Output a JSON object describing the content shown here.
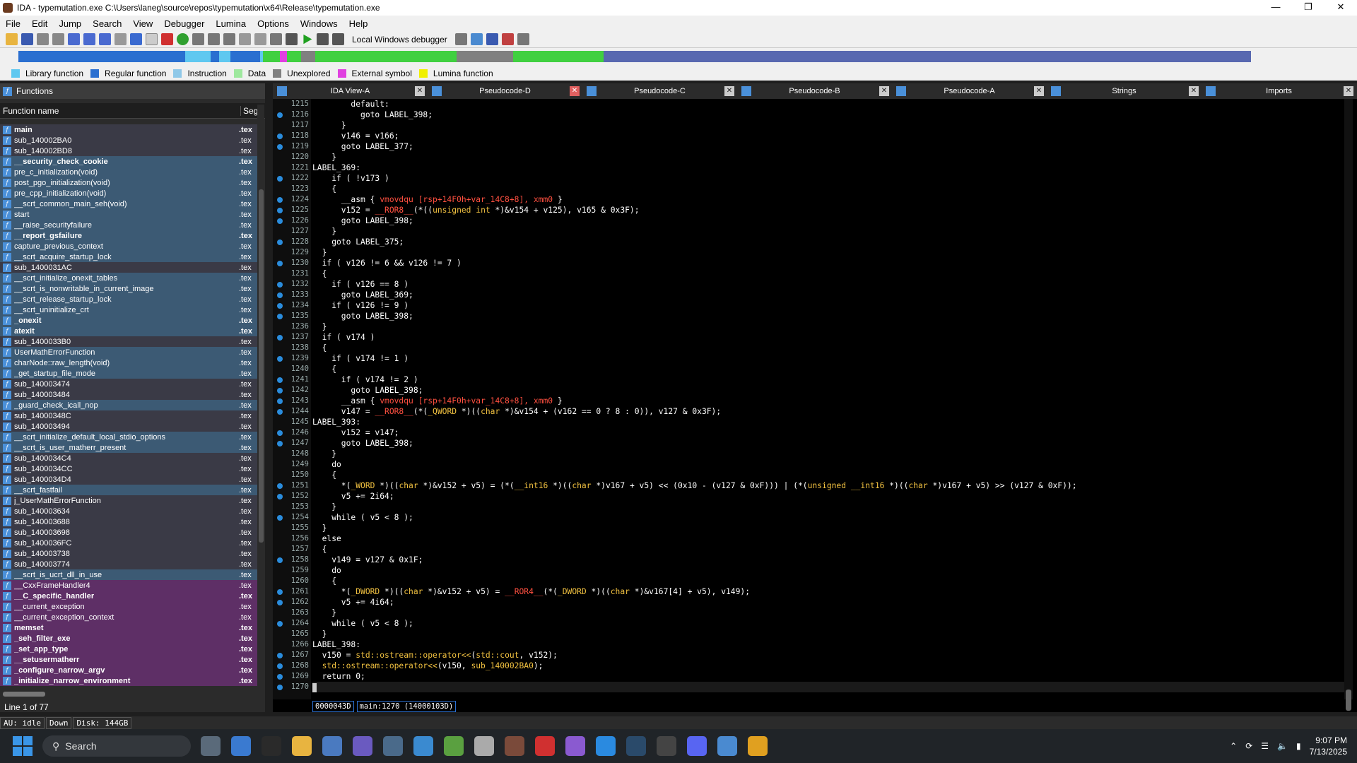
{
  "window": {
    "title": "IDA - typemutation.exe C:\\Users\\laneg\\source\\repos\\typemutation\\x64\\Release\\typemutation.exe",
    "minimize": "—",
    "maximize": "❐",
    "close": "✕"
  },
  "menu": [
    "File",
    "Edit",
    "Jump",
    "Search",
    "View",
    "Debugger",
    "Lumina",
    "Options",
    "Windows",
    "Help"
  ],
  "toolbar": {
    "debugger_label": "Local Windows debugger"
  },
  "legend": [
    {
      "label": "Library function",
      "color": "#5fc8f0"
    },
    {
      "label": "Regular function",
      "color": "#2a6fd0"
    },
    {
      "label": "Instruction",
      "color": "#8fc8e8"
    },
    {
      "label": "Data",
      "color": "#9ee89e"
    },
    {
      "label": "Unexplored",
      "color": "#808080"
    },
    {
      "label": "External symbol",
      "color": "#e040e0"
    },
    {
      "label": "Lumina function",
      "color": "#f0f000"
    }
  ],
  "functions_panel": {
    "title": "Functions",
    "col_name": "Function name",
    "col_seg": "Seg",
    "status": "Line 1 of 77",
    "rows": [
      {
        "name": "main",
        "seg": ".tex",
        "bold": true,
        "kind": "reg"
      },
      {
        "name": "sub_140002BA0",
        "seg": ".tex",
        "bold": false,
        "kind": "reg"
      },
      {
        "name": "sub_140002BD8",
        "seg": ".tex",
        "bold": false,
        "kind": "reg"
      },
      {
        "name": "__security_check_cookie",
        "seg": ".tex",
        "bold": true,
        "kind": "lib"
      },
      {
        "name": "pre_c_initialization(void)",
        "seg": ".tex",
        "bold": false,
        "kind": "lib"
      },
      {
        "name": "post_pgo_initialization(void)",
        "seg": ".tex",
        "bold": false,
        "kind": "lib"
      },
      {
        "name": "pre_cpp_initialization(void)",
        "seg": ".tex",
        "bold": false,
        "kind": "lib"
      },
      {
        "name": "__scrt_common_main_seh(void)",
        "seg": ".tex",
        "bold": false,
        "kind": "lib"
      },
      {
        "name": "start",
        "seg": ".tex",
        "bold": false,
        "kind": "lib"
      },
      {
        "name": "__raise_securityfailure",
        "seg": ".tex",
        "bold": false,
        "kind": "lib"
      },
      {
        "name": "__report_gsfailure",
        "seg": ".tex",
        "bold": true,
        "kind": "lib"
      },
      {
        "name": "capture_previous_context",
        "seg": ".tex",
        "bold": false,
        "kind": "lib"
      },
      {
        "name": "__scrt_acquire_startup_lock",
        "seg": ".tex",
        "bold": false,
        "kind": "lib"
      },
      {
        "name": "sub_1400031AC",
        "seg": ".tex",
        "bold": false,
        "kind": "reg"
      },
      {
        "name": "__scrt_initialize_onexit_tables",
        "seg": ".tex",
        "bold": false,
        "kind": "lib"
      },
      {
        "name": "__scrt_is_nonwritable_in_current_image",
        "seg": ".tex",
        "bold": false,
        "kind": "lib"
      },
      {
        "name": "__scrt_release_startup_lock",
        "seg": ".tex",
        "bold": false,
        "kind": "lib"
      },
      {
        "name": "__scrt_uninitialize_crt",
        "seg": ".tex",
        "bold": false,
        "kind": "lib"
      },
      {
        "name": "_onexit",
        "seg": ".tex",
        "bold": true,
        "kind": "lib"
      },
      {
        "name": "atexit",
        "seg": ".tex",
        "bold": true,
        "kind": "lib"
      },
      {
        "name": "sub_1400033B0",
        "seg": ".tex",
        "bold": false,
        "kind": "reg"
      },
      {
        "name": "UserMathErrorFunction",
        "seg": ".tex",
        "bold": false,
        "kind": "lib"
      },
      {
        "name": "charNode::raw_length(void)",
        "seg": ".tex",
        "bold": false,
        "kind": "lib"
      },
      {
        "name": "_get_startup_file_mode",
        "seg": ".tex",
        "bold": false,
        "kind": "lib"
      },
      {
        "name": "sub_140003474",
        "seg": ".tex",
        "bold": false,
        "kind": "reg"
      },
      {
        "name": "sub_140003484",
        "seg": ".tex",
        "bold": false,
        "kind": "reg"
      },
      {
        "name": "_guard_check_icall_nop",
        "seg": ".tex",
        "bold": false,
        "kind": "lib"
      },
      {
        "name": "sub_14000348C",
        "seg": ".tex",
        "bold": false,
        "kind": "reg"
      },
      {
        "name": "sub_140003494",
        "seg": ".tex",
        "bold": false,
        "kind": "reg"
      },
      {
        "name": "__scrt_initialize_default_local_stdio_options",
        "seg": ".tex",
        "bold": false,
        "kind": "lib"
      },
      {
        "name": "__scrt_is_user_matherr_present",
        "seg": ".tex",
        "bold": false,
        "kind": "lib"
      },
      {
        "name": "sub_1400034C4",
        "seg": ".tex",
        "bold": false,
        "kind": "reg"
      },
      {
        "name": "sub_1400034CC",
        "seg": ".tex",
        "bold": false,
        "kind": "reg"
      },
      {
        "name": "sub_1400034D4",
        "seg": ".tex",
        "bold": false,
        "kind": "reg"
      },
      {
        "name": "__scrt_fastfail",
        "seg": ".tex",
        "bold": false,
        "kind": "lib"
      },
      {
        "name": "j_UserMathErrorFunction",
        "seg": ".tex",
        "bold": false,
        "kind": "reg"
      },
      {
        "name": "sub_140003634",
        "seg": ".tex",
        "bold": false,
        "kind": "reg"
      },
      {
        "name": "sub_140003688",
        "seg": ".tex",
        "bold": false,
        "kind": "reg"
      },
      {
        "name": "sub_140003698",
        "seg": ".tex",
        "bold": false,
        "kind": "reg"
      },
      {
        "name": "sub_1400036FC",
        "seg": ".tex",
        "bold": false,
        "kind": "reg"
      },
      {
        "name": "sub_140003738",
        "seg": ".tex",
        "bold": false,
        "kind": "reg"
      },
      {
        "name": "sub_140003774",
        "seg": ".tex",
        "bold": false,
        "kind": "reg"
      },
      {
        "name": "__scrt_is_ucrt_dll_in_use",
        "seg": ".tex",
        "bold": false,
        "kind": "lib"
      },
      {
        "name": "__CxxFrameHandler4",
        "seg": ".tex",
        "bold": false,
        "kind": "ext"
      },
      {
        "name": "__C_specific_handler",
        "seg": ".tex",
        "bold": true,
        "kind": "ext"
      },
      {
        "name": "__current_exception",
        "seg": ".tex",
        "bold": false,
        "kind": "ext"
      },
      {
        "name": "__current_exception_context",
        "seg": ".tex",
        "bold": false,
        "kind": "ext"
      },
      {
        "name": "memset",
        "seg": ".tex",
        "bold": true,
        "kind": "ext"
      },
      {
        "name": "_seh_filter_exe",
        "seg": ".tex",
        "bold": true,
        "kind": "ext"
      },
      {
        "name": "_set_app_type",
        "seg": ".tex",
        "bold": true,
        "kind": "ext"
      },
      {
        "name": "__setusermatherr",
        "seg": ".tex",
        "bold": true,
        "kind": "ext"
      },
      {
        "name": "_configure_narrow_argv",
        "seg": ".tex",
        "bold": true,
        "kind": "ext"
      },
      {
        "name": "_initialize_narrow_environment",
        "seg": ".tex",
        "bold": true,
        "kind": "ext"
      }
    ]
  },
  "tabs": [
    {
      "label": "IDA View-A",
      "active": false
    },
    {
      "label": "Pseudocode-D",
      "active": true
    },
    {
      "label": "Pseudocode-C",
      "active": false
    },
    {
      "label": "Pseudocode-B",
      "active": false
    },
    {
      "label": "Pseudocode-A",
      "active": false
    },
    {
      "label": "Strings",
      "active": false
    },
    {
      "label": "Imports",
      "active": false
    }
  ],
  "code": {
    "lines": [
      {
        "n": "1215",
        "dot": false,
        "html": "        default:"
      },
      {
        "n": "1216",
        "dot": true,
        "html": "          goto LABEL_398;"
      },
      {
        "n": "1217",
        "dot": false,
        "html": "      }"
      },
      {
        "n": "1218",
        "dot": true,
        "html": "      v146 = v166;"
      },
      {
        "n": "1219",
        "dot": true,
        "html": "      goto LABEL_377;"
      },
      {
        "n": "1220",
        "dot": false,
        "html": "    }"
      },
      {
        "n": "1221",
        "dot": false,
        "html": "LABEL_369:"
      },
      {
        "n": "1222",
        "dot": true,
        "html": "    if ( !v173 )"
      },
      {
        "n": "1223",
        "dot": false,
        "html": "    {"
      },
      {
        "n": "1224",
        "dot": true,
        "html": "      __asm { <span class=\"a\">vmovdqu [rsp+14F0h+var_14C8+8], xmm0</span> }"
      },
      {
        "n": "1225",
        "dot": true,
        "html": "      v152 = <span class=\"a\">__ROR8__</span>(*((<span class=\"t\">unsigned int</span> *)&amp;v154 + v125), v165 &amp; 0x3F);"
      },
      {
        "n": "1226",
        "dot": true,
        "html": "      goto LABEL_398;"
      },
      {
        "n": "1227",
        "dot": false,
        "html": "    }"
      },
      {
        "n": "1228",
        "dot": true,
        "html": "    goto LABEL_375;"
      },
      {
        "n": "1229",
        "dot": false,
        "html": "  }"
      },
      {
        "n": "1230",
        "dot": true,
        "html": "  if ( v126 != 6 &amp;&amp; v126 != 7 )"
      },
      {
        "n": "1231",
        "dot": false,
        "html": "  {"
      },
      {
        "n": "1232",
        "dot": true,
        "html": "    if ( v126 == 8 )"
      },
      {
        "n": "1233",
        "dot": true,
        "html": "      goto LABEL_369;"
      },
      {
        "n": "1234",
        "dot": true,
        "html": "    if ( v126 != 9 )"
      },
      {
        "n": "1235",
        "dot": true,
        "html": "      goto LABEL_398;"
      },
      {
        "n": "1236",
        "dot": false,
        "html": "  }"
      },
      {
        "n": "1237",
        "dot": true,
        "html": "  if ( v174 )"
      },
      {
        "n": "1238",
        "dot": false,
        "html": "  {"
      },
      {
        "n": "1239",
        "dot": true,
        "html": "    if ( v174 != 1 )"
      },
      {
        "n": "1240",
        "dot": false,
        "html": "    {"
      },
      {
        "n": "1241",
        "dot": true,
        "html": "      if ( v174 != 2 )"
      },
      {
        "n": "1242",
        "dot": true,
        "html": "        goto LABEL_398;"
      },
      {
        "n": "1243",
        "dot": true,
        "html": "      __asm { <span class=\"a\">vmovdqu [rsp+14F0h+var_14C8+8], xmm0</span> }"
      },
      {
        "n": "1244",
        "dot": true,
        "html": "      v147 = <span class=\"a\">__ROR8__</span>(*(<span class=\"t\">_QWORD</span> *)((<span class=\"t\">char</span> *)&amp;v154 + (v162 == 0 ? 8 : 0)), v127 &amp; 0x3F);"
      },
      {
        "n": "1245",
        "dot": false,
        "html": "LABEL_393:"
      },
      {
        "n": "1246",
        "dot": true,
        "html": "      v152 = v147;"
      },
      {
        "n": "1247",
        "dot": true,
        "html": "      goto LABEL_398;"
      },
      {
        "n": "1248",
        "dot": false,
        "html": "    }"
      },
      {
        "n": "1249",
        "dot": false,
        "html": "    do"
      },
      {
        "n": "1250",
        "dot": false,
        "html": "    {"
      },
      {
        "n": "1251",
        "dot": true,
        "html": "      *(<span class=\"t\">_WORD</span> *)((<span class=\"t\">char</span> *)&amp;v152 + v5) = (*(<span class=\"t\">__int16</span> *)((<span class=\"t\">char</span> *)v167 + v5) &lt;&lt; (0x10 - (v127 &amp; 0xF))) | (*(<span class=\"t\">unsigned __int16</span> *)((<span class=\"t\">char</span> *)v167 + v5) &gt;&gt; (v127 &amp; 0xF));"
      },
      {
        "n": "1252",
        "dot": true,
        "html": "      v5 += 2i64;"
      },
      {
        "n": "1253",
        "dot": false,
        "html": "    }"
      },
      {
        "n": "1254",
        "dot": true,
        "html": "    while ( v5 &lt; 8 );"
      },
      {
        "n": "1255",
        "dot": false,
        "html": "  }"
      },
      {
        "n": "1256",
        "dot": false,
        "html": "  else"
      },
      {
        "n": "1257",
        "dot": false,
        "html": "  {"
      },
      {
        "n": "1258",
        "dot": true,
        "html": "    v149 = v127 &amp; 0x1F;"
      },
      {
        "n": "1259",
        "dot": false,
        "html": "    do"
      },
      {
        "n": "1260",
        "dot": false,
        "html": "    {"
      },
      {
        "n": "1261",
        "dot": true,
        "html": "      *(<span class=\"t\">_DWORD</span> *)((<span class=\"t\">char</span> *)&amp;v152 + v5) = <span class=\"a\">__ROR4__</span>(*(<span class=\"t\">_DWORD</span> *)((<span class=\"t\">char</span> *)&amp;v167[4] + v5), v149);"
      },
      {
        "n": "1262",
        "dot": true,
        "html": "      v5 += 4i64;"
      },
      {
        "n": "1263",
        "dot": false,
        "html": "    }"
      },
      {
        "n": "1264",
        "dot": true,
        "html": "    while ( v5 &lt; 8 );"
      },
      {
        "n": "1265",
        "dot": false,
        "html": "  }"
      },
      {
        "n": "1266",
        "dot": false,
        "html": "LABEL_398:"
      },
      {
        "n": "1267",
        "dot": true,
        "html": "  v150 = <span class=\"t\">std::ostream::operator&lt;&lt;</span>(<span class=\"t\">std::cout</span>, v152);"
      },
      {
        "n": "1268",
        "dot": true,
        "html": "  <span class=\"t\">std::ostream::operator&lt;&lt;</span>(v150, <span class=\"t\">sub_140002BA0</span>);"
      },
      {
        "n": "1269",
        "dot": true,
        "html": "  return 0;"
      },
      {
        "n": "1270",
        "dot": true,
        "html": "",
        "cursor": true
      }
    ],
    "status_offset": "0000043D",
    "status_location": "main:1270 (14000103D)"
  },
  "statusbar": {
    "au": "AU:  idle",
    "dir": "Down",
    "disk": "Disk: 144GB"
  },
  "taskbar": {
    "search_placeholder": "Search",
    "time": "9:07 PM",
    "date": "7/13/2025",
    "icons": [
      {
        "name": "settings-icon",
        "color": "#5a6a7a"
      },
      {
        "name": "store-icon",
        "color": "#3a7ad0"
      },
      {
        "name": "terminal-icon",
        "color": "#2a2a2a"
      },
      {
        "name": "file-explorer-icon",
        "color": "#e8b440"
      },
      {
        "name": "photos-icon",
        "color": "#4a7ac0"
      },
      {
        "name": "devhome-icon",
        "color": "#6a5ac0"
      },
      {
        "name": "calculator-icon",
        "color": "#4a6a8a"
      },
      {
        "name": "notepad-icon",
        "color": "#3a8ad0"
      },
      {
        "name": "notes-icon",
        "color": "#5aa040"
      },
      {
        "name": "x64dbg-icon",
        "color": "#aaa"
      },
      {
        "name": "ida-icon",
        "color": "#7a4a3a"
      },
      {
        "name": "todoist-icon",
        "color": "#d03030"
      },
      {
        "name": "visual-studio-icon",
        "color": "#8a5ad0"
      },
      {
        "name": "vscode-icon",
        "color": "#2a8ae0"
      },
      {
        "name": "steam-icon",
        "color": "#2a4a6a"
      },
      {
        "name": "app-a-icon",
        "color": "#444"
      },
      {
        "name": "discord-icon",
        "color": "#5865f2"
      },
      {
        "name": "controlpanel-icon",
        "color": "#4a8ad0"
      },
      {
        "name": "chrome-icon",
        "color": "#e0a020"
      }
    ]
  }
}
